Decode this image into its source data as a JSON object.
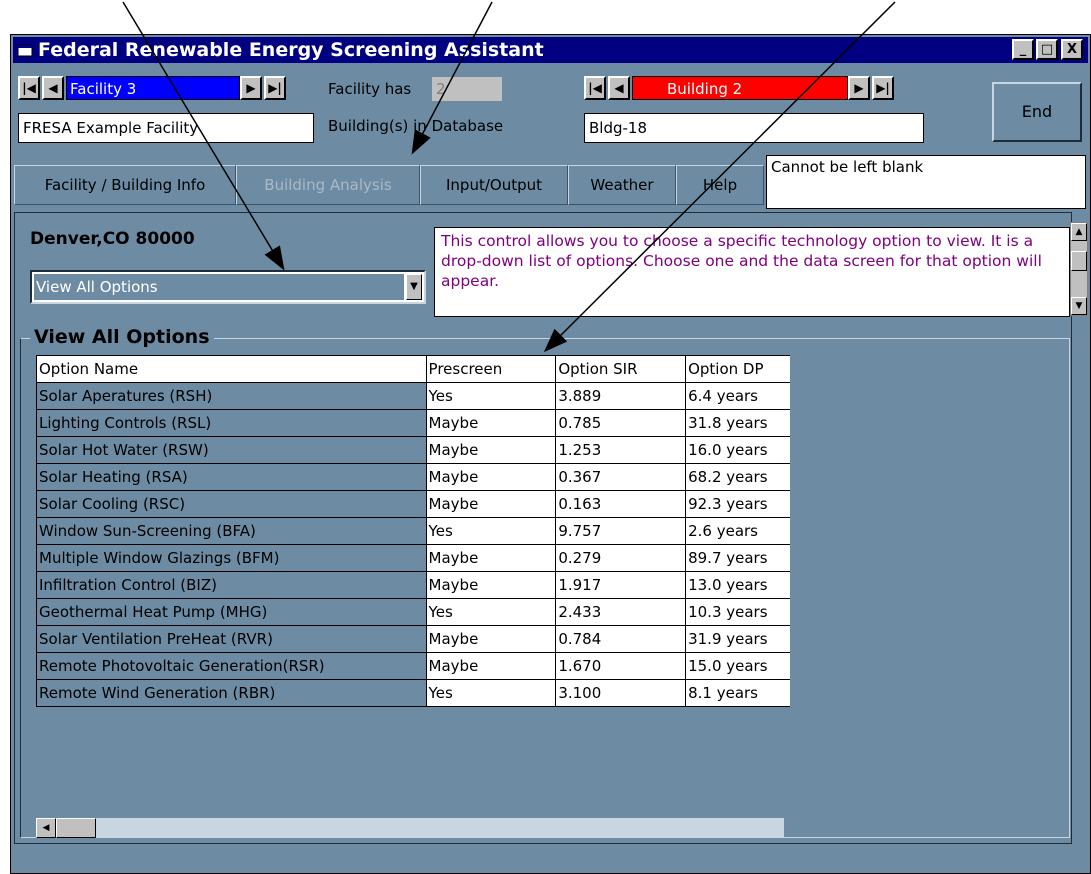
{
  "window": {
    "title": "Federal Renewable Energy Screening Assistant",
    "controls": [
      "_",
      "□",
      "X"
    ]
  },
  "facility": {
    "selector_label": "Facility 3",
    "name": "FRESA Example Facility",
    "has_label": "Facility has",
    "building_count": "2",
    "buildings_label": "Building(s) in Database"
  },
  "building": {
    "selector_label": "Building 2",
    "name": "Bldg-18"
  },
  "buttons": {
    "end": "End"
  },
  "tabs": [
    "Facility / Building Info",
    "Building Analysis",
    "Input/Output",
    "Weather",
    "Help"
  ],
  "status_message": "Cannot be left blank",
  "location": "Denver,CO 80000",
  "option_dropdown": {
    "value": "View All Options"
  },
  "help_text": "This control allows you to choose a specific technology option to view.  It is a drop-down list of options.  Choose one and the data screen for that option will appear.",
  "group_title": "View All Options",
  "table": {
    "headers": [
      "Option Name",
      "Prescreen",
      "Option SIR",
      "Option DP"
    ],
    "rows": [
      [
        "Solar Aperatures (RSH)",
        "Yes",
        "3.889",
        "6.4 years"
      ],
      [
        "Lighting Controls (RSL)",
        "Maybe",
        "0.785",
        "31.8 years"
      ],
      [
        "Solar Hot Water (RSW)",
        "Maybe",
        "1.253",
        "16.0 years"
      ],
      [
        "Solar Heating (RSA)",
        "Maybe",
        "0.367",
        "68.2 years"
      ],
      [
        "Solar Cooling (RSC)",
        "Maybe",
        "0.163",
        "92.3 years"
      ],
      [
        "Window Sun-Screening (BFA)",
        "Yes",
        "9.757",
        "2.6 years"
      ],
      [
        "Multiple Window Glazings (BFM)",
        "Maybe",
        "0.279",
        "89.7 years"
      ],
      [
        "Infiltration Control (BIZ)",
        "Maybe",
        "1.917",
        "13.0 years"
      ],
      [
        "Geothermal Heat Pump (MHG)",
        "Yes",
        "2.433",
        "10.3 years"
      ],
      [
        "Solar Ventilation PreHeat (RVR)",
        "Maybe",
        "0.784",
        "31.9 years"
      ],
      [
        "Remote Photovoltaic Generation(RSR)",
        "Maybe",
        "1.670",
        "15.0 years"
      ],
      [
        "Remote Wind Generation (RBR)",
        "Yes",
        "3.100",
        "8.1 years"
      ]
    ]
  },
  "colors": {
    "window_bg": "#6d8ca3",
    "titlebar": "#000080",
    "facility_selector": "#0000ff",
    "building_selector": "#ff0000",
    "help_text": "#800080"
  }
}
